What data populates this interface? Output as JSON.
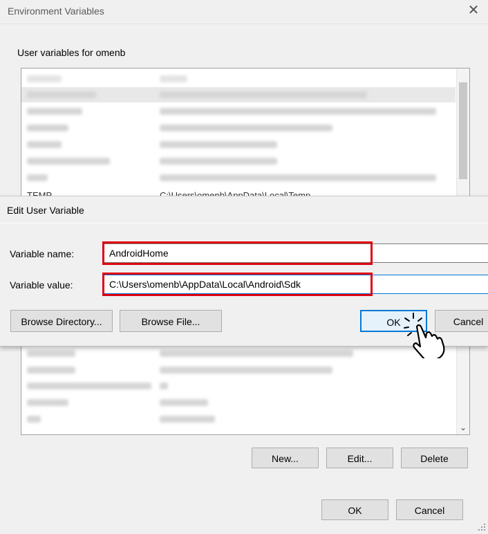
{
  "env_window": {
    "title": "Environment Variables",
    "user_group_label": "User variables for omenb",
    "partial_row": {
      "name": "TEMP",
      "value": "C:\\Users\\omenb\\AppData\\Local\\Temp"
    },
    "buttons": {
      "new": "New...",
      "edit": "Edit...",
      "delete": "Delete"
    },
    "footer": {
      "ok": "OK",
      "cancel": "Cancel"
    }
  },
  "edit_dialog": {
    "title": "Edit User Variable",
    "name_label": "Variable name:",
    "name_value": "AndroidHome",
    "value_label": "Variable value:",
    "value_value": "C:\\Users\\omenb\\AppData\\Local\\Android\\Sdk",
    "buttons": {
      "browse_directory": "Browse Directory...",
      "browse_file": "Browse File...",
      "ok": "OK",
      "cancel": "Cancel"
    }
  },
  "annotation_color": "#e0000f",
  "icons": {
    "close": "close-icon",
    "scroll_down": "chevron-down-icon",
    "cursor": "hand-pointer-icon"
  }
}
